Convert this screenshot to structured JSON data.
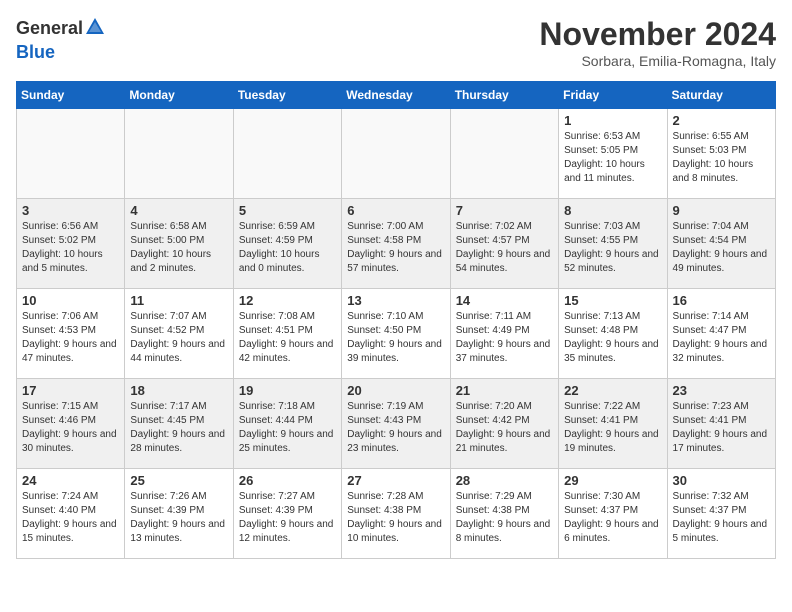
{
  "header": {
    "logo_line1": "General",
    "logo_line2": "Blue",
    "month": "November 2024",
    "location": "Sorbara, Emilia-Romagna, Italy"
  },
  "weekdays": [
    "Sunday",
    "Monday",
    "Tuesday",
    "Wednesday",
    "Thursday",
    "Friday",
    "Saturday"
  ],
  "weeks": [
    [
      {
        "day": "",
        "info": "",
        "empty": true
      },
      {
        "day": "",
        "info": "",
        "empty": true
      },
      {
        "day": "",
        "info": "",
        "empty": true
      },
      {
        "day": "",
        "info": "",
        "empty": true
      },
      {
        "day": "",
        "info": "",
        "empty": true
      },
      {
        "day": "1",
        "info": "Sunrise: 6:53 AM\nSunset: 5:05 PM\nDaylight: 10 hours and 11 minutes."
      },
      {
        "day": "2",
        "info": "Sunrise: 6:55 AM\nSunset: 5:03 PM\nDaylight: 10 hours and 8 minutes."
      }
    ],
    [
      {
        "day": "3",
        "info": "Sunrise: 6:56 AM\nSunset: 5:02 PM\nDaylight: 10 hours and 5 minutes."
      },
      {
        "day": "4",
        "info": "Sunrise: 6:58 AM\nSunset: 5:00 PM\nDaylight: 10 hours and 2 minutes."
      },
      {
        "day": "5",
        "info": "Sunrise: 6:59 AM\nSunset: 4:59 PM\nDaylight: 10 hours and 0 minutes."
      },
      {
        "day": "6",
        "info": "Sunrise: 7:00 AM\nSunset: 4:58 PM\nDaylight: 9 hours and 57 minutes."
      },
      {
        "day": "7",
        "info": "Sunrise: 7:02 AM\nSunset: 4:57 PM\nDaylight: 9 hours and 54 minutes."
      },
      {
        "day": "8",
        "info": "Sunrise: 7:03 AM\nSunset: 4:55 PM\nDaylight: 9 hours and 52 minutes."
      },
      {
        "day": "9",
        "info": "Sunrise: 7:04 AM\nSunset: 4:54 PM\nDaylight: 9 hours and 49 minutes."
      }
    ],
    [
      {
        "day": "10",
        "info": "Sunrise: 7:06 AM\nSunset: 4:53 PM\nDaylight: 9 hours and 47 minutes."
      },
      {
        "day": "11",
        "info": "Sunrise: 7:07 AM\nSunset: 4:52 PM\nDaylight: 9 hours and 44 minutes."
      },
      {
        "day": "12",
        "info": "Sunrise: 7:08 AM\nSunset: 4:51 PM\nDaylight: 9 hours and 42 minutes."
      },
      {
        "day": "13",
        "info": "Sunrise: 7:10 AM\nSunset: 4:50 PM\nDaylight: 9 hours and 39 minutes."
      },
      {
        "day": "14",
        "info": "Sunrise: 7:11 AM\nSunset: 4:49 PM\nDaylight: 9 hours and 37 minutes."
      },
      {
        "day": "15",
        "info": "Sunrise: 7:13 AM\nSunset: 4:48 PM\nDaylight: 9 hours and 35 minutes."
      },
      {
        "day": "16",
        "info": "Sunrise: 7:14 AM\nSunset: 4:47 PM\nDaylight: 9 hours and 32 minutes."
      }
    ],
    [
      {
        "day": "17",
        "info": "Sunrise: 7:15 AM\nSunset: 4:46 PM\nDaylight: 9 hours and 30 minutes."
      },
      {
        "day": "18",
        "info": "Sunrise: 7:17 AM\nSunset: 4:45 PM\nDaylight: 9 hours and 28 minutes."
      },
      {
        "day": "19",
        "info": "Sunrise: 7:18 AM\nSunset: 4:44 PM\nDaylight: 9 hours and 25 minutes."
      },
      {
        "day": "20",
        "info": "Sunrise: 7:19 AM\nSunset: 4:43 PM\nDaylight: 9 hours and 23 minutes."
      },
      {
        "day": "21",
        "info": "Sunrise: 7:20 AM\nSunset: 4:42 PM\nDaylight: 9 hours and 21 minutes."
      },
      {
        "day": "22",
        "info": "Sunrise: 7:22 AM\nSunset: 4:41 PM\nDaylight: 9 hours and 19 minutes."
      },
      {
        "day": "23",
        "info": "Sunrise: 7:23 AM\nSunset: 4:41 PM\nDaylight: 9 hours and 17 minutes."
      }
    ],
    [
      {
        "day": "24",
        "info": "Sunrise: 7:24 AM\nSunset: 4:40 PM\nDaylight: 9 hours and 15 minutes."
      },
      {
        "day": "25",
        "info": "Sunrise: 7:26 AM\nSunset: 4:39 PM\nDaylight: 9 hours and 13 minutes."
      },
      {
        "day": "26",
        "info": "Sunrise: 7:27 AM\nSunset: 4:39 PM\nDaylight: 9 hours and 12 minutes."
      },
      {
        "day": "27",
        "info": "Sunrise: 7:28 AM\nSunset: 4:38 PM\nDaylight: 9 hours and 10 minutes."
      },
      {
        "day": "28",
        "info": "Sunrise: 7:29 AM\nSunset: 4:38 PM\nDaylight: 9 hours and 8 minutes."
      },
      {
        "day": "29",
        "info": "Sunrise: 7:30 AM\nSunset: 4:37 PM\nDaylight: 9 hours and 6 minutes."
      },
      {
        "day": "30",
        "info": "Sunrise: 7:32 AM\nSunset: 4:37 PM\nDaylight: 9 hours and 5 minutes."
      }
    ]
  ]
}
